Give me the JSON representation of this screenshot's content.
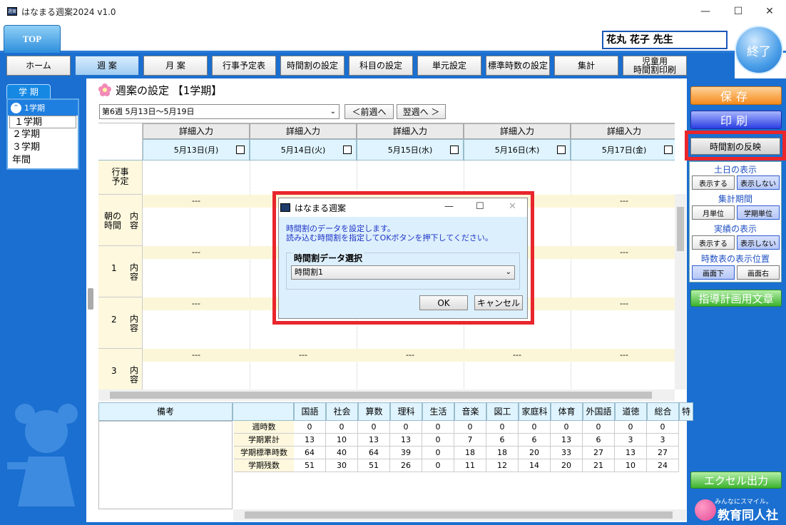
{
  "window": {
    "title": "はなまる週案2024 v1.0",
    "icon_text": "週案",
    "min_glyph": "—",
    "max_glyph": "☐",
    "close_glyph": "✕"
  },
  "header": {
    "top_tab": "TOP",
    "user_name": "花丸 花子 先生",
    "exit_label": "終了"
  },
  "nav": [
    "ホーム",
    "週 案",
    "月 案",
    "行事予定表",
    "時間割の設定",
    "科目の設定",
    "単元設定",
    "標準時数の設定",
    "集計",
    "児童用\n時間割印刷"
  ],
  "term": {
    "tab_label": "学 期",
    "current": "1学期",
    "options": [
      "１学期",
      "２学期",
      "３学期",
      "年間"
    ]
  },
  "section": {
    "title": "週案の設定 【1学期】",
    "week_select": "第6週 5月13日～5月19日",
    "prev_week": "＜前週へ",
    "next_week": "翌週へ ＞"
  },
  "grid": {
    "detail_label": "詳細入力",
    "dates": [
      "5月13日(月)",
      "5月14日(火)",
      "5月15日(水)",
      "5月16日(木)",
      "5月17日(金)"
    ],
    "rows": {
      "event": "行事\n予定",
      "morning": "朝の\n時間",
      "content": "内\n容",
      "p1": "1",
      "p2": "2",
      "p3": "3"
    },
    "dash": "---"
  },
  "summary": {
    "note_header": "備考",
    "subjects": [
      "国語",
      "社会",
      "算数",
      "理科",
      "生活",
      "音楽",
      "図工",
      "家庭科",
      "体育",
      "外国語",
      "道徳",
      "総合",
      "特"
    ],
    "row_labels": [
      "週時数",
      "学期累計",
      "学期標準時数",
      "学期残数"
    ],
    "rows": [
      [
        "0",
        "0",
        "0",
        "0",
        "0",
        "0",
        "0",
        "0",
        "0",
        "0",
        "0",
        "0"
      ],
      [
        "13",
        "10",
        "13",
        "13",
        "0",
        "7",
        "6",
        "6",
        "13",
        "6",
        "3",
        "3"
      ],
      [
        "64",
        "40",
        "64",
        "39",
        "0",
        "18",
        "18",
        "20",
        "33",
        "27",
        "13",
        "27"
      ],
      [
        "51",
        "30",
        "51",
        "26",
        "0",
        "11",
        "12",
        "14",
        "20",
        "21",
        "10",
        "24"
      ]
    ]
  },
  "right_panel": {
    "save": "保存",
    "print": "印刷",
    "apply_timetable": "時間割の反映",
    "weekend_label": "土日の表示",
    "show": "表示する",
    "hide": "表示しない",
    "period_label": "集計期間",
    "monthly": "月単位",
    "term_unit": "学期単位",
    "actual_label": "実績の表示",
    "position_label": "時数表の表示位置",
    "pos_bottom": "画面下",
    "pos_right": "画面右",
    "guidance_text": "指導計画用文章",
    "excel": "エクセル出力"
  },
  "logo": {
    "tagline": "みんなにスマイル。",
    "name": "教育同人社"
  },
  "dialog": {
    "title": "はなまる週案",
    "message_line1": "時間割のデータを設定します。",
    "message_line2": "読み込む時間割を指定してOKボタンを押下してください。",
    "group_label": "時間割データ選択",
    "selected": "時間割1",
    "ok": "OK",
    "cancel": "キャンセル"
  },
  "colors": {
    "frame_blue": "#1a6fd0",
    "highlight_red": "#e8262c",
    "save_orange": "#f58a1c",
    "print_blue": "#2a3ee2",
    "green": "#3cb32e"
  }
}
